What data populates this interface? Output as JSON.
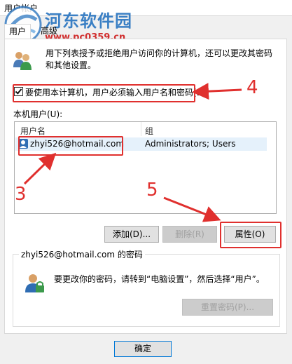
{
  "window": {
    "title": "用户帐户"
  },
  "watermark": {
    "line1": "河东软件园",
    "line2": "www.pc0359.cn"
  },
  "tabs": [
    {
      "label": "用户"
    },
    {
      "label": "高级"
    }
  ],
  "intro": {
    "text": "用下列表授予或拒绝用户访问你的计算机，还可以更改其密码和其他设置。"
  },
  "require_login": {
    "label": "要使用本计算机，用户必须输入用户名和密码(E)",
    "checked": true
  },
  "users_list": {
    "label": "本机用户(U):",
    "columns": [
      "用户名",
      "组"
    ],
    "rows": [
      {
        "username": "zhyi526@hotmail.com",
        "group": "Administrators; Users"
      }
    ]
  },
  "buttons": {
    "add": "添加(D)...",
    "remove": "删除(R)",
    "properties": "属性(O)"
  },
  "password_group": {
    "title": "zhyi526@hotmail.com 的密码",
    "text": "要更改你的密码，请转到“电脑设置”，然后选择“用户”。",
    "reset_button": "重置密码(P)..."
  },
  "ok_button": "确定",
  "annotations": {
    "n3": "3",
    "n4": "4",
    "n5": "5",
    "color": "#e0302e"
  },
  "colors": {
    "highlight": "#e0302e",
    "selection": "#e5f1fb",
    "watermark_blue": "#3a7fc4"
  }
}
